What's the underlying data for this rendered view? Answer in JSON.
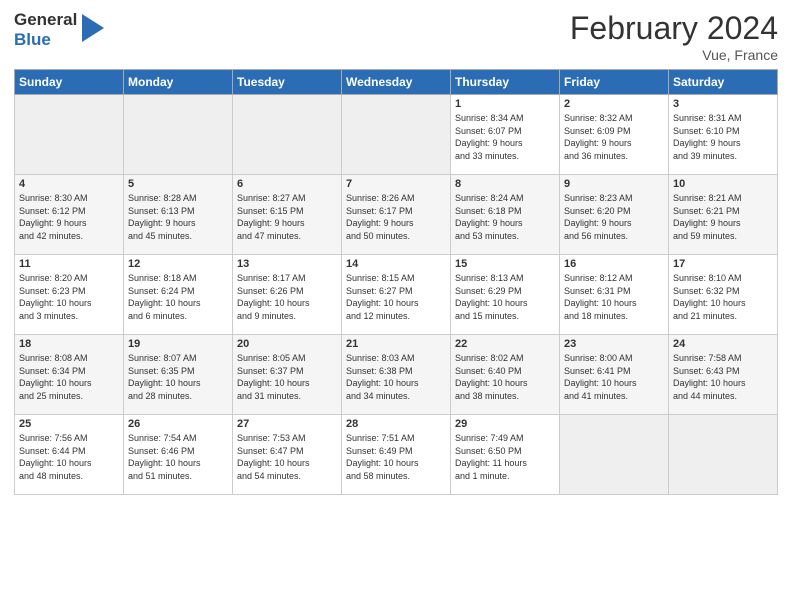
{
  "logo": {
    "general": "General",
    "blue": "Blue"
  },
  "title": "February 2024",
  "subtitle": "Vue, France",
  "days_of_week": [
    "Sunday",
    "Monday",
    "Tuesday",
    "Wednesday",
    "Thursday",
    "Friday",
    "Saturday"
  ],
  "weeks": [
    [
      {
        "day": "",
        "info": ""
      },
      {
        "day": "",
        "info": ""
      },
      {
        "day": "",
        "info": ""
      },
      {
        "day": "",
        "info": ""
      },
      {
        "day": "1",
        "info": "Sunrise: 8:34 AM\nSunset: 6:07 PM\nDaylight: 9 hours\nand 33 minutes."
      },
      {
        "day": "2",
        "info": "Sunrise: 8:32 AM\nSunset: 6:09 PM\nDaylight: 9 hours\nand 36 minutes."
      },
      {
        "day": "3",
        "info": "Sunrise: 8:31 AM\nSunset: 6:10 PM\nDaylight: 9 hours\nand 39 minutes."
      }
    ],
    [
      {
        "day": "4",
        "info": "Sunrise: 8:30 AM\nSunset: 6:12 PM\nDaylight: 9 hours\nand 42 minutes."
      },
      {
        "day": "5",
        "info": "Sunrise: 8:28 AM\nSunset: 6:13 PM\nDaylight: 9 hours\nand 45 minutes."
      },
      {
        "day": "6",
        "info": "Sunrise: 8:27 AM\nSunset: 6:15 PM\nDaylight: 9 hours\nand 47 minutes."
      },
      {
        "day": "7",
        "info": "Sunrise: 8:26 AM\nSunset: 6:17 PM\nDaylight: 9 hours\nand 50 minutes."
      },
      {
        "day": "8",
        "info": "Sunrise: 8:24 AM\nSunset: 6:18 PM\nDaylight: 9 hours\nand 53 minutes."
      },
      {
        "day": "9",
        "info": "Sunrise: 8:23 AM\nSunset: 6:20 PM\nDaylight: 9 hours\nand 56 minutes."
      },
      {
        "day": "10",
        "info": "Sunrise: 8:21 AM\nSunset: 6:21 PM\nDaylight: 9 hours\nand 59 minutes."
      }
    ],
    [
      {
        "day": "11",
        "info": "Sunrise: 8:20 AM\nSunset: 6:23 PM\nDaylight: 10 hours\nand 3 minutes."
      },
      {
        "day": "12",
        "info": "Sunrise: 8:18 AM\nSunset: 6:24 PM\nDaylight: 10 hours\nand 6 minutes."
      },
      {
        "day": "13",
        "info": "Sunrise: 8:17 AM\nSunset: 6:26 PM\nDaylight: 10 hours\nand 9 minutes."
      },
      {
        "day": "14",
        "info": "Sunrise: 8:15 AM\nSunset: 6:27 PM\nDaylight: 10 hours\nand 12 minutes."
      },
      {
        "day": "15",
        "info": "Sunrise: 8:13 AM\nSunset: 6:29 PM\nDaylight: 10 hours\nand 15 minutes."
      },
      {
        "day": "16",
        "info": "Sunrise: 8:12 AM\nSunset: 6:31 PM\nDaylight: 10 hours\nand 18 minutes."
      },
      {
        "day": "17",
        "info": "Sunrise: 8:10 AM\nSunset: 6:32 PM\nDaylight: 10 hours\nand 21 minutes."
      }
    ],
    [
      {
        "day": "18",
        "info": "Sunrise: 8:08 AM\nSunset: 6:34 PM\nDaylight: 10 hours\nand 25 minutes."
      },
      {
        "day": "19",
        "info": "Sunrise: 8:07 AM\nSunset: 6:35 PM\nDaylight: 10 hours\nand 28 minutes."
      },
      {
        "day": "20",
        "info": "Sunrise: 8:05 AM\nSunset: 6:37 PM\nDaylight: 10 hours\nand 31 minutes."
      },
      {
        "day": "21",
        "info": "Sunrise: 8:03 AM\nSunset: 6:38 PM\nDaylight: 10 hours\nand 34 minutes."
      },
      {
        "day": "22",
        "info": "Sunrise: 8:02 AM\nSunset: 6:40 PM\nDaylight: 10 hours\nand 38 minutes."
      },
      {
        "day": "23",
        "info": "Sunrise: 8:00 AM\nSunset: 6:41 PM\nDaylight: 10 hours\nand 41 minutes."
      },
      {
        "day": "24",
        "info": "Sunrise: 7:58 AM\nSunset: 6:43 PM\nDaylight: 10 hours\nand 44 minutes."
      }
    ],
    [
      {
        "day": "25",
        "info": "Sunrise: 7:56 AM\nSunset: 6:44 PM\nDaylight: 10 hours\nand 48 minutes."
      },
      {
        "day": "26",
        "info": "Sunrise: 7:54 AM\nSunset: 6:46 PM\nDaylight: 10 hours\nand 51 minutes."
      },
      {
        "day": "27",
        "info": "Sunrise: 7:53 AM\nSunset: 6:47 PM\nDaylight: 10 hours\nand 54 minutes."
      },
      {
        "day": "28",
        "info": "Sunrise: 7:51 AM\nSunset: 6:49 PM\nDaylight: 10 hours\nand 58 minutes."
      },
      {
        "day": "29",
        "info": "Sunrise: 7:49 AM\nSunset: 6:50 PM\nDaylight: 11 hours\nand 1 minute."
      },
      {
        "day": "",
        "info": ""
      },
      {
        "day": "",
        "info": ""
      }
    ]
  ]
}
